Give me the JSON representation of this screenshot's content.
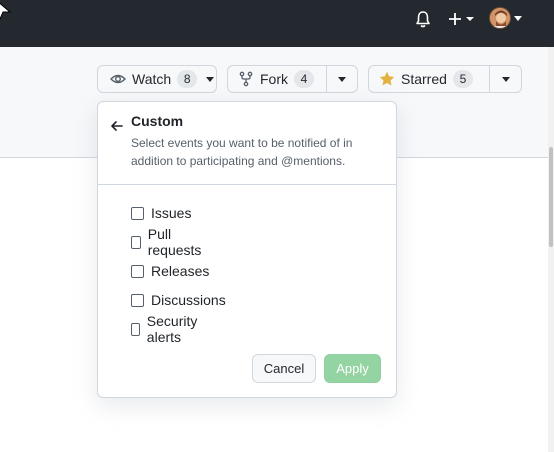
{
  "topbar": {
    "icons": [
      "bell-icon",
      "plus-icon",
      "avatar"
    ]
  },
  "repo_actions": {
    "watch": {
      "label": "Watch",
      "count": "8",
      "icon": "eye-icon"
    },
    "fork": {
      "label": "Fork",
      "count": "4",
      "icon": "fork-icon"
    },
    "star": {
      "label": "Starred",
      "count": "5",
      "icon": "star-filled-icon",
      "star_color": "#e3b341"
    }
  },
  "custom_panel": {
    "title": "Custom",
    "description": "Select events you want to be notified of in addition to participating and @mentions.",
    "options": [
      {
        "label": "Issues",
        "checked": false
      },
      {
        "label": "Pull requests",
        "checked": false
      },
      {
        "label": "Releases",
        "checked": false
      },
      {
        "label": "Discussions",
        "checked": false
      },
      {
        "label": "Security alerts",
        "checked": false
      }
    ],
    "cancel_label": "Cancel",
    "apply_label": "Apply",
    "apply_color": "#94d3a2"
  },
  "colors": {
    "topbar": "#24292f",
    "header_bg": "#f6f8fa",
    "border": "#d0d7de"
  }
}
